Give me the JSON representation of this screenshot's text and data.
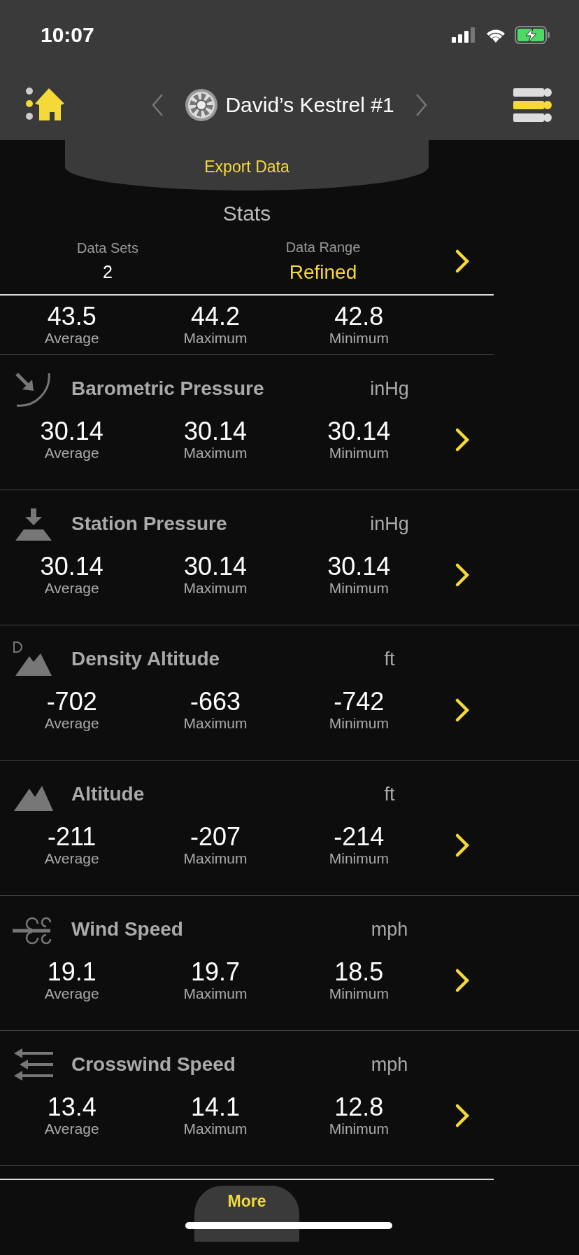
{
  "status_bar": {
    "time": "10:07"
  },
  "nav": {
    "device_name": "David’s Kestrel #1"
  },
  "export_tab": {
    "label": "Export Data"
  },
  "title": "Stats",
  "summary": [
    {
      "label": "Data Sets",
      "value": "2",
      "kind": "plain"
    },
    {
      "label": "Data Range",
      "value": "Refined",
      "kind": "highlight"
    }
  ],
  "partial_row": {
    "values": [
      {
        "value": "43.5",
        "label": "Average"
      },
      {
        "value": "44.2",
        "label": "Maximum"
      },
      {
        "value": "42.8",
        "label": "Minimum"
      }
    ]
  },
  "rows": [
    {
      "kind": "barometric",
      "name": "Barometric Pressure",
      "unit": "inHg",
      "values": [
        {
          "value": "30.14",
          "label": "Average"
        },
        {
          "value": "30.14",
          "label": "Maximum"
        },
        {
          "value": "30.14",
          "label": "Minimum"
        }
      ]
    },
    {
      "kind": "station",
      "name": "Station Pressure",
      "unit": "inHg",
      "values": [
        {
          "value": "30.14",
          "label": "Average"
        },
        {
          "value": "30.14",
          "label": "Maximum"
        },
        {
          "value": "30.14",
          "label": "Minimum"
        }
      ]
    },
    {
      "kind": "density",
      "name": "Density Altitude",
      "unit": "ft",
      "values": [
        {
          "value": "-702",
          "label": "Average"
        },
        {
          "value": "-663",
          "label": "Maximum"
        },
        {
          "value": "-742",
          "label": "Minimum"
        }
      ]
    },
    {
      "kind": "altitude",
      "name": "Altitude",
      "unit": "ft",
      "values": [
        {
          "value": "-211",
          "label": "Average"
        },
        {
          "value": "-207",
          "label": "Maximum"
        },
        {
          "value": "-214",
          "label": "Minimum"
        }
      ]
    },
    {
      "kind": "wind",
      "name": "Wind Speed",
      "unit": "mph",
      "values": [
        {
          "value": "19.1",
          "label": "Average"
        },
        {
          "value": "19.7",
          "label": "Maximum"
        },
        {
          "value": "18.5",
          "label": "Minimum"
        }
      ]
    },
    {
      "kind": "crosswind",
      "name": "Crosswind Speed",
      "unit": "mph",
      "values": [
        {
          "value": "13.4",
          "label": "Average"
        },
        {
          "value": "14.1",
          "label": "Maximum"
        },
        {
          "value": "12.8",
          "label": "Minimum"
        }
      ]
    }
  ],
  "more_tab": {
    "label": "More"
  }
}
